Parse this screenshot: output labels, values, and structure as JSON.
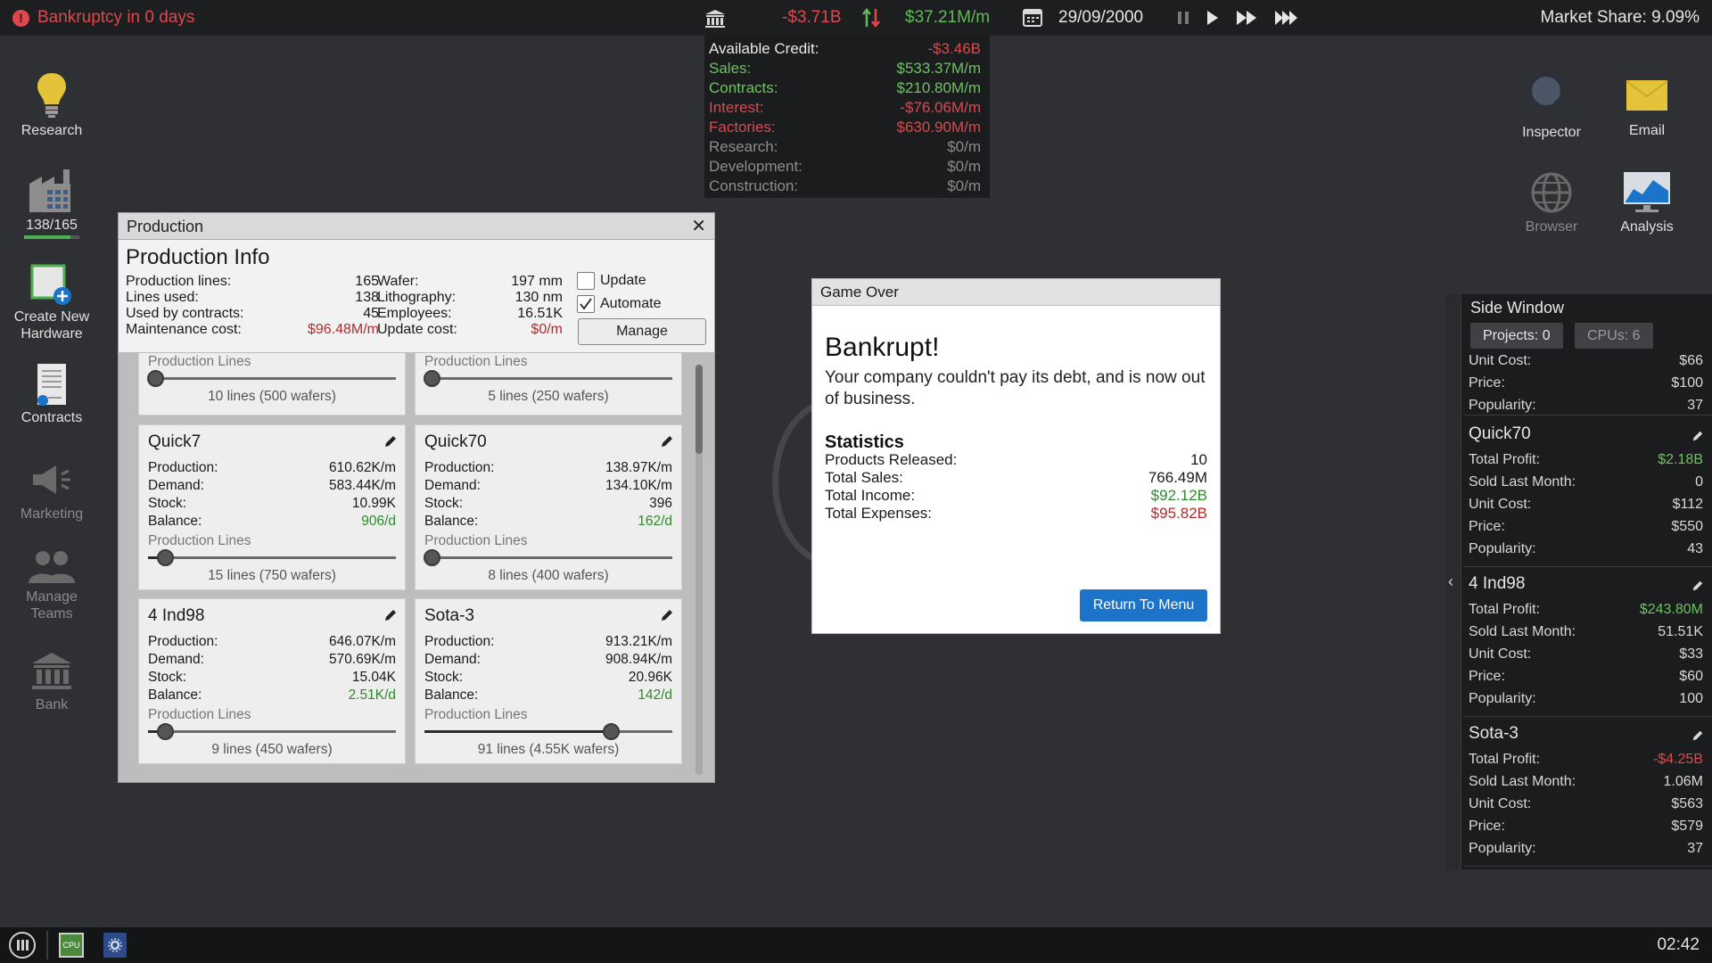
{
  "topbar": {
    "alert": "Bankruptcy in 0 days",
    "balance": "-$3.71B",
    "cashflow": "$37.21M/m",
    "date": "29/09/2000",
    "market_share": "Market Share: 9.09%"
  },
  "finance": [
    {
      "label": "Available Credit:",
      "value": "-$3.46B",
      "label_color": "white",
      "value_color": "red"
    },
    {
      "label": "Sales:",
      "value": "$533.37M/m",
      "label_color": "green",
      "value_color": "green"
    },
    {
      "label": "Contracts:",
      "value": "$210.80M/m",
      "label_color": "green",
      "value_color": "green"
    },
    {
      "label": "Interest:",
      "value": "-$76.06M/m",
      "label_color": "red",
      "value_color": "red"
    },
    {
      "label": "Factories:",
      "value": "$630.90M/m",
      "label_color": "red",
      "value_color": "red"
    },
    {
      "label": "Research:",
      "value": "$0/m",
      "label_color": "grey",
      "value_color": "grey"
    },
    {
      "label": "Development:",
      "value": "$0/m",
      "label_color": "grey",
      "value_color": "grey"
    },
    {
      "label": "Construction:",
      "value": "$0/m",
      "label_color": "grey",
      "value_color": "grey"
    }
  ],
  "dock": {
    "research": "Research",
    "factory_count": "138/165",
    "factory_fill": 0.836,
    "create_hardware": "Create New\nHardware",
    "contracts": "Contracts",
    "marketing": "Marketing",
    "manage_teams": "Manage\nTeams",
    "bank": "Bank"
  },
  "right_icons": {
    "inspector": "Inspector",
    "email": "Email",
    "browser": "Browser",
    "analysis": "Analysis"
  },
  "production": {
    "window_title": "Production",
    "info_title": "Production Info",
    "left_rows": [
      {
        "label": "Production lines:",
        "value": "165",
        "color": "normal"
      },
      {
        "label": "Lines used:",
        "value": "138",
        "color": "normal"
      },
      {
        "label": "Used by contracts:",
        "value": "45",
        "color": "normal"
      },
      {
        "label": "Maintenance cost:",
        "value": "$96.48M/m",
        "color": "red"
      }
    ],
    "mid_rows": [
      {
        "label": "Wafer:",
        "value": "197 mm",
        "color": "normal"
      },
      {
        "label": "Lithography:",
        "value": "130 nm",
        "color": "normal"
      },
      {
        "label": "Employees:",
        "value": "16.51K",
        "color": "normal"
      },
      {
        "label": "Update cost:",
        "value": "$0/m",
        "color": "red"
      }
    ],
    "update_label": "Update",
    "automate_label": "Automate",
    "manage_label": "Manage",
    "production_lines_label": "Production Lines",
    "top_partial_cards": [
      {
        "caption": "10 lines (500 wafers)",
        "slider": 0.03
      },
      {
        "caption": "5 lines (250 wafers)",
        "slider": 0.03
      }
    ],
    "cards": [
      {
        "name": "Quick7",
        "production": "610.62K/m",
        "demand": "583.44K/m",
        "stock": "10.99K",
        "balance": "906/d",
        "caption": "15 lines (750 wafers)",
        "slider": 0.07
      },
      {
        "name": "Quick70",
        "production": "138.97K/m",
        "demand": "134.10K/m",
        "stock": "396",
        "balance": "162/d",
        "caption": "8 lines (400 wafers)",
        "slider": 0.03
      },
      {
        "name": "4 Ind98",
        "production": "646.07K/m",
        "demand": "570.69K/m",
        "stock": "15.04K",
        "balance": "2.51K/d",
        "caption": "9 lines (450 wafers)",
        "slider": 0.07
      },
      {
        "name": "Sota-3",
        "production": "913.21K/m",
        "demand": "908.94K/m",
        "stock": "20.96K",
        "balance": "142/d",
        "caption": "91 lines (4.55K wafers)",
        "slider": 0.75
      }
    ],
    "row_labels": {
      "production": "Production:",
      "demand": "Demand:",
      "stock": "Stock:",
      "balance": "Balance:"
    }
  },
  "game_over": {
    "title": "Game Over",
    "heading": "Bankrupt!",
    "message": "Your company couldn't pay its debt, and is now out of business.",
    "stats_title": "Statistics",
    "stats": [
      {
        "label": "Products Released:",
        "value": "10",
        "color": "normal"
      },
      {
        "label": "Total Sales:",
        "value": "766.49M",
        "color": "normal"
      },
      {
        "label": "Total Income:",
        "value": "$92.12B",
        "color": "green"
      },
      {
        "label": "Total Expenses:",
        "value": "$95.82B",
        "color": "red"
      }
    ],
    "button": "Return To Menu"
  },
  "side_window": {
    "title": "Side Window",
    "projects_tab": "Projects: 0",
    "cpus_tab": "CPUs: 6",
    "labels": {
      "profit": "Total Profit:",
      "sold": "Sold Last Month:",
      "unit": "Unit Cost:",
      "price": "Price:",
      "popularity": "Popularity:"
    },
    "partial": {
      "unit_cost": "$66",
      "price": "$100",
      "popularity": "37"
    },
    "products": [
      {
        "name": "Quick70",
        "profit": "$2.18B",
        "profit_color": "green",
        "sold": "0",
        "unit_cost": "$112",
        "price": "$550",
        "popularity": "43"
      },
      {
        "name": "4 Ind98",
        "profit": "$243.80M",
        "profit_color": "green",
        "sold": "51.51K",
        "unit_cost": "$33",
        "price": "$60",
        "popularity": "100"
      },
      {
        "name": "Sota-3",
        "profit": "-$4.25B",
        "profit_color": "red",
        "sold": "1.06M",
        "unit_cost": "$563",
        "price": "$579",
        "popularity": "37"
      }
    ]
  },
  "taskbar": {
    "cpu_icon_text": "CPU",
    "clock": "02:42"
  },
  "colors": {
    "accent_blue": "#1b74c9",
    "alert_red": "#e0474c",
    "positive_green": "#62b85b",
    "bulb_yellow": "#e2c33a"
  }
}
